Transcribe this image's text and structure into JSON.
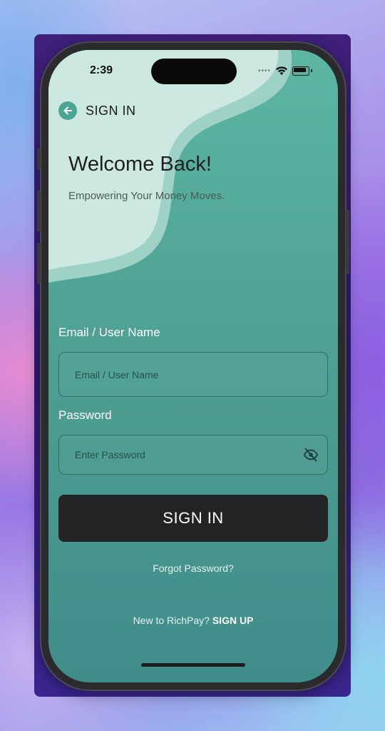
{
  "status_bar": {
    "time": "2:39"
  },
  "header": {
    "title": "SIGN IN",
    "back_icon": "arrow-left-icon"
  },
  "hero": {
    "heading": "Welcome Back!",
    "tagline": "Empowering Your Money Moves."
  },
  "form": {
    "email": {
      "label": "Email / User Name",
      "placeholder": "Email / User Name",
      "value": ""
    },
    "password": {
      "label": "Password",
      "placeholder": "Enter Password",
      "value": "",
      "toggle_icon": "eye-off-icon"
    },
    "submit_label": "SIGN IN",
    "forgot_label": "Forgot Password?"
  },
  "footer": {
    "prompt": "New to RichPay?",
    "signup_label": "SIGN UP"
  },
  "colors": {
    "accent": "#4aa593",
    "button": "#232325",
    "wave_light": "#cde8e1",
    "wave_mid": "#9fd2c6"
  }
}
